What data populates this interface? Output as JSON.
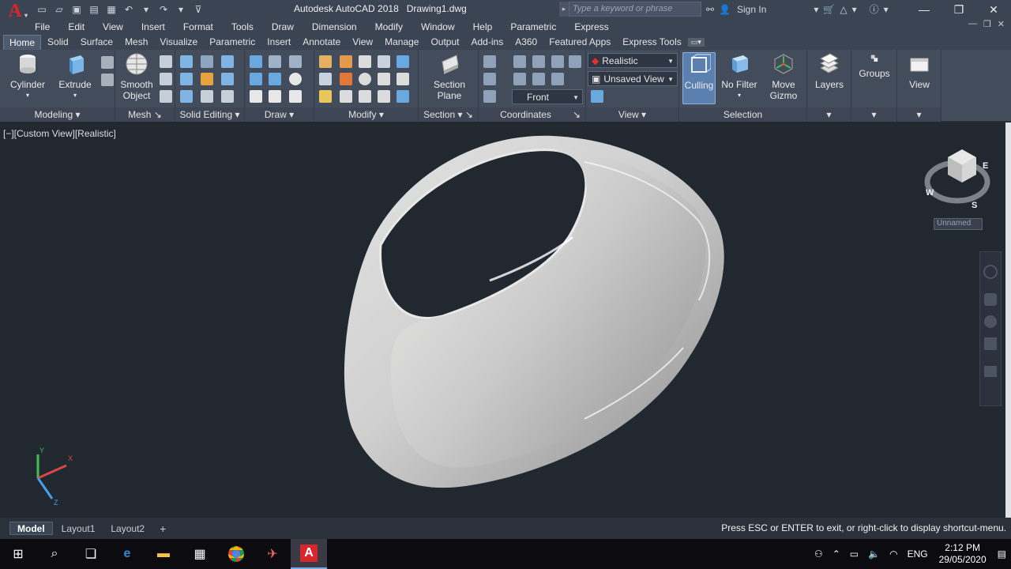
{
  "app": {
    "logo_letter": "A",
    "title": "Autodesk AutoCAD 2018",
    "filename": "Drawing1.dwg"
  },
  "search": {
    "placeholder": "Type a keyword or phrase"
  },
  "header": {
    "sign_in": "Sign In"
  },
  "menu": [
    "File",
    "Edit",
    "View",
    "Insert",
    "Format",
    "Tools",
    "Draw",
    "Dimension",
    "Modify",
    "Window",
    "Help",
    "Parametric",
    "Express"
  ],
  "tabs": [
    "Home",
    "Solid",
    "Surface",
    "Mesh",
    "Visualize",
    "Parametric",
    "Insert",
    "Annotate",
    "View",
    "Manage",
    "Output",
    "Add-ins",
    "A360",
    "Featured Apps",
    "Express Tools"
  ],
  "ribbon": {
    "cylinder": "Cylinder",
    "extrude": "Extrude",
    "smooth_object_1": "Smooth",
    "smooth_object_2": "Object",
    "section_plane_1": "Section",
    "section_plane_2": "Plane",
    "culling": "Culling",
    "no_filter": "No Filter",
    "move_gizmo_1": "Move",
    "move_gizmo_2": "Gizmo",
    "layers": "Layers",
    "groups": "Groups",
    "view": "View",
    "visual_style": "Realistic",
    "named_view": "Unsaved View",
    "ucs_view": "Front",
    "panels": {
      "modeling": "Modeling",
      "mesh": "Mesh",
      "solid_editing": "Solid Editing",
      "draw": "Draw",
      "modify": "Modify",
      "section": "Section",
      "coordinates": "Coordinates",
      "view": "View",
      "selection": "Selection"
    }
  },
  "viewport": {
    "label": "[−][Custom View][Realistic]",
    "viewcube_label": "Unnamed"
  },
  "layouts": {
    "model": "Model",
    "layout1": "Layout1",
    "layout2": "Layout2",
    "add": "+"
  },
  "command_prompt": "Press ESC or ENTER to exit, or right-click to display shortcut-menu.",
  "tray": {
    "language": "ENG",
    "time": "2:12 PM",
    "date": "29/05/2020"
  },
  "colors": {
    "background": "#212830",
    "ribbon": "#434c5b",
    "accent_red": "#d7262e",
    "culling_active": "#5b7fae"
  }
}
